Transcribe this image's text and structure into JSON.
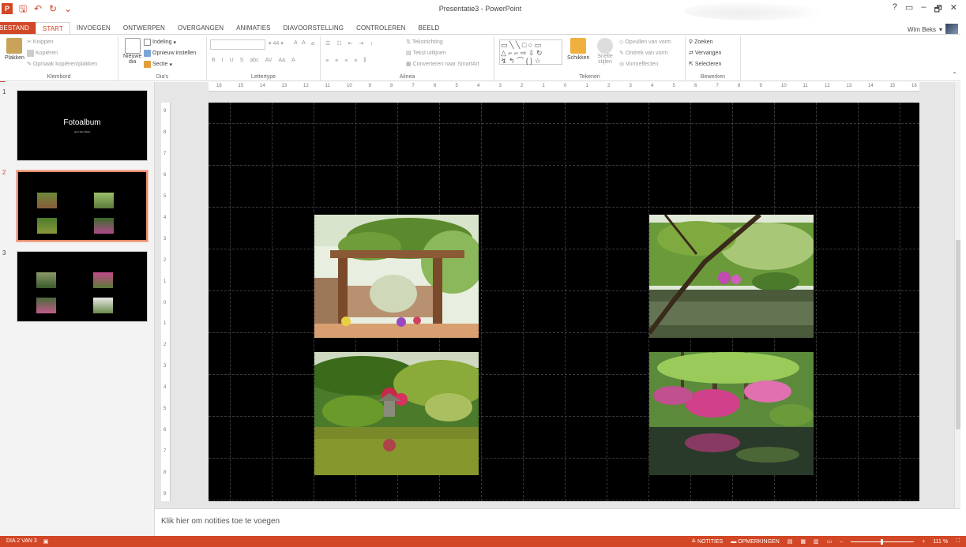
{
  "window": {
    "title": "Presentatie3 - PowerPoint",
    "help": "?",
    "minimize": "–",
    "restore": "🗗",
    "close": "✕"
  },
  "qat": {
    "save": "🖫",
    "undo": "↶",
    "redo": "↻",
    "customize": "⌄"
  },
  "tabs": [
    "BESTAND",
    "START",
    "INVOEGEN",
    "ONTWERPEN",
    "OVERGANGEN",
    "ANIMATIES",
    "DIAVOORSTELLING",
    "CONTROLEREN",
    "BEELD"
  ],
  "user": {
    "name": "Wim Beks"
  },
  "ribbon": {
    "clipboard": {
      "label": "Klembord",
      "paste": "Plakken",
      "cut": "Knippen",
      "copy": "Kopiëren",
      "format_painter": "Opmaak kopiëren/plakken"
    },
    "slides": {
      "label": "Dia's",
      "new_slide_1": "Nieuwe",
      "new_slide_2": "dia",
      "layout": "Indeling",
      "reset": "Opnieuw instellen",
      "section": "Sectie"
    },
    "font": {
      "label": "Lettertype",
      "size": "44",
      "bold": "B",
      "italic": "I",
      "underline": "U",
      "shadow": "S",
      "strike": "abc",
      "spacing": "AV",
      "case": "Aa",
      "color": "A",
      "grow": "A",
      "shrink": "A"
    },
    "paragraph": {
      "label": "Alinea",
      "text_direction": "Tekstrichting",
      "align_text": "Tekst uitlijnen",
      "smartart": "Converteren naar SmartArt"
    },
    "drawing": {
      "label": "Tekenen",
      "arrange": "Schikken",
      "quick_styles_1": "Snelle",
      "quick_styles_2": "stijlen",
      "fill": "Opvullen van vorm",
      "outline": "Omtrek van vorm",
      "effects": "Vormeffecten"
    },
    "editing": {
      "label": "Bewerken",
      "find": "Zoeken",
      "replace": "Vervangen",
      "select": "Selecteren"
    }
  },
  "ruler": {
    "h": [
      "16",
      "15",
      "14",
      "13",
      "12",
      "11",
      "10",
      "9",
      "8",
      "7",
      "6",
      "5",
      "4",
      "3",
      "2",
      "1",
      "0",
      "1",
      "2",
      "3",
      "4",
      "5",
      "6",
      "7",
      "8",
      "9",
      "10",
      "11",
      "12",
      "13",
      "14",
      "15",
      "16"
    ],
    "v": [
      "9",
      "8",
      "7",
      "6",
      "5",
      "4",
      "3",
      "2",
      "1",
      "0",
      "1",
      "2",
      "3",
      "4",
      "5",
      "6",
      "7",
      "8",
      "9"
    ]
  },
  "thumbnails": [
    {
      "number": "1",
      "title": "Fotoalbum",
      "subtitle": "door Wim Beks"
    },
    {
      "number": "2"
    },
    {
      "number": "3"
    }
  ],
  "notes": {
    "placeholder": "Klik hier om notities toe te voegen"
  },
  "status": {
    "slide": "DIA 2 VAN 3",
    "notes": "NOTITIES",
    "comments": "OPMERKINGEN",
    "zoom": "111 %"
  }
}
